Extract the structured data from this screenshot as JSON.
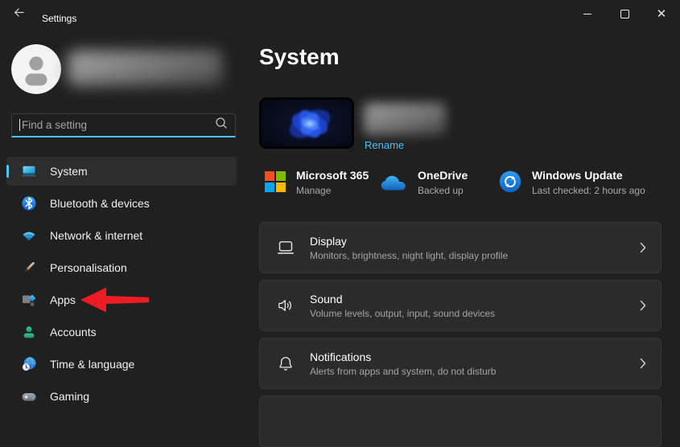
{
  "titlebar": {
    "title": "Settings"
  },
  "search": {
    "placeholder": "Find a setting"
  },
  "sidebar": {
    "items": [
      {
        "label": "System",
        "selected": true
      },
      {
        "label": "Bluetooth & devices",
        "selected": false
      },
      {
        "label": "Network & internet",
        "selected": false
      },
      {
        "label": "Personalisation",
        "selected": false
      },
      {
        "label": "Apps",
        "selected": false
      },
      {
        "label": "Accounts",
        "selected": false
      },
      {
        "label": "Time & language",
        "selected": false
      },
      {
        "label": "Gaming",
        "selected": false
      }
    ]
  },
  "main": {
    "title": "System",
    "device": {
      "rename": "Rename"
    },
    "cards": [
      {
        "title": "Microsoft 365",
        "subtitle": "Manage"
      },
      {
        "title": "OneDrive",
        "subtitle": "Backed up"
      },
      {
        "title": "Windows Update",
        "subtitle": "Last checked: 2 hours ago"
      }
    ],
    "rows": [
      {
        "title": "Display",
        "subtitle": "Monitors, brightness, night light, display profile"
      },
      {
        "title": "Sound",
        "subtitle": "Volume levels, output, input, sound devices"
      },
      {
        "title": "Notifications",
        "subtitle": "Alerts from apps and system, do not disturb"
      }
    ]
  },
  "colors": {
    "accent": "#4cc2ff",
    "annotation_arrow": "#ec1c24"
  }
}
